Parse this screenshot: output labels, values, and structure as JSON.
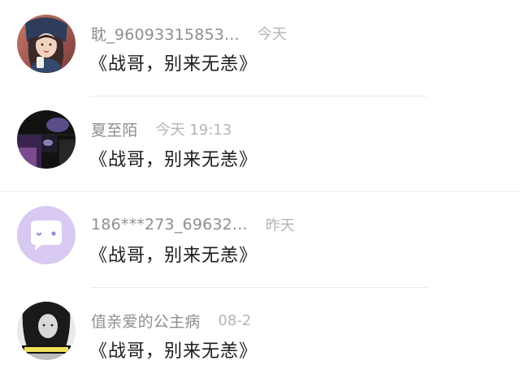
{
  "comments": [
    {
      "username": "耽_96093315853...",
      "time": "今天",
      "content": "《战哥，别来无恙》",
      "avatar": "avatar-girl-illustration"
    },
    {
      "username": "夏至陌",
      "time": "今天 19:13",
      "content": "《战哥，别来无恙》",
      "avatar": "avatar-dark-photo"
    },
    {
      "username": "186***273_69632...",
      "time": "昨天",
      "content": "《战哥，别来无恙》",
      "avatar": "avatar-default-chat-bubble"
    },
    {
      "username": "值亲爱的公主病",
      "time": "08-2",
      "content": "《战哥，别来无恙》",
      "avatar": "avatar-monochrome-photo"
    }
  ],
  "colors": {
    "username": "#8e8e93",
    "timestamp": "#b4b4b8",
    "content": "#1c1c1e",
    "default_avatar_bg": "#d8c9f2",
    "divider": "#ececec"
  }
}
